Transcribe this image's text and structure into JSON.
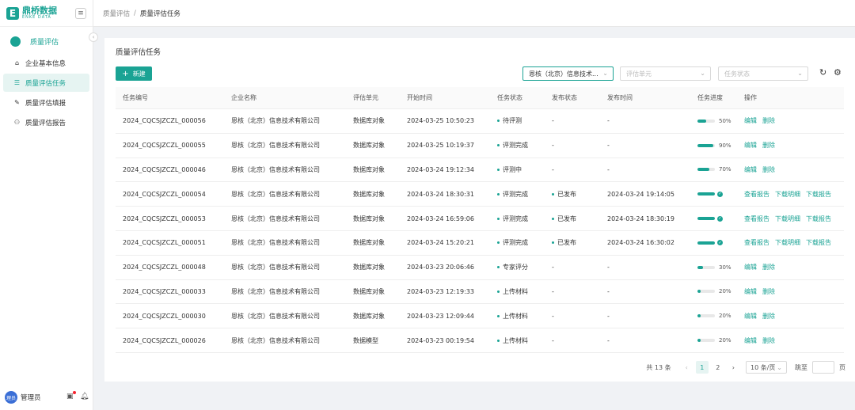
{
  "brand": {
    "logo_letter": "E",
    "name_cn": "鼎桥数据",
    "name_en": "ENKE DATA"
  },
  "sidebar": {
    "section_label": "质量评估",
    "items": [
      {
        "label": "企业基本信息",
        "icon": "building-icon",
        "glyph": "⌂",
        "active": false
      },
      {
        "label": "质量评估任务",
        "icon": "task-icon",
        "glyph": "☰",
        "active": true
      },
      {
        "label": "质量评估填报",
        "icon": "form-icon",
        "glyph": "✎",
        "active": false
      },
      {
        "label": "质量评估报告",
        "icon": "user-report-icon",
        "glyph": "⚇",
        "active": false
      }
    ]
  },
  "user": {
    "avatar_text": "理员",
    "name": "管理员"
  },
  "breadcrumb": {
    "parent": "质量评估",
    "separator": "/",
    "current": "质量评估任务"
  },
  "card": {
    "title": "质量评估任务",
    "new_button": "新建",
    "filters": {
      "company": "恩核（北京）信息技术...",
      "unit_placeholder": "评估单元",
      "status_placeholder": "任务状态"
    }
  },
  "colors": {
    "accent": "#1aa394"
  },
  "table": {
    "headers": [
      "任务编号",
      "企业名称",
      "评估单元",
      "开始时间",
      "任务状态",
      "发布状态",
      "发布时间",
      "任务进度",
      "操作"
    ],
    "rows": [
      {
        "code": "2024_CQCSJZCZL_000056",
        "company": "恩核（北京）信息技术有限公司",
        "unit": "数据库对象",
        "start": "2024-03-25 10:50:23",
        "status": "待评测",
        "pub_status": "-",
        "pub_time": "-",
        "progress": 50,
        "progress_label": "50%",
        "complete": false,
        "ops": [
          "编辑",
          "删除"
        ]
      },
      {
        "code": "2024_CQCSJZCZL_000055",
        "company": "恩核（北京）信息技术有限公司",
        "unit": "数据库对象",
        "start": "2024-03-25 10:19:37",
        "status": "评测完成",
        "pub_status": "-",
        "pub_time": "-",
        "progress": 90,
        "progress_label": "90%",
        "complete": false,
        "ops": [
          "编辑",
          "删除"
        ]
      },
      {
        "code": "2024_CQCSJZCZL_000046",
        "company": "恩核（北京）信息技术有限公司",
        "unit": "数据库对象",
        "start": "2024-03-24 19:12:34",
        "status": "评测中",
        "pub_status": "-",
        "pub_time": "-",
        "progress": 70,
        "progress_label": "70%",
        "complete": false,
        "ops": [
          "编辑",
          "删除"
        ]
      },
      {
        "code": "2024_CQCSJZCZL_000054",
        "company": "恩核（北京）信息技术有限公司",
        "unit": "数据库对象",
        "start": "2024-03-24 18:30:31",
        "status": "评测完成",
        "pub_status": "已发布",
        "pub_time": "2024-03-24 19:14:05",
        "progress": 100,
        "progress_label": "",
        "complete": true,
        "ops": [
          "查看报告",
          "下载明细",
          "下载报告"
        ]
      },
      {
        "code": "2024_CQCSJZCZL_000053",
        "company": "恩核（北京）信息技术有限公司",
        "unit": "数据库对象",
        "start": "2024-03-24 16:59:06",
        "status": "评测完成",
        "pub_status": "已发布",
        "pub_time": "2024-03-24 18:30:19",
        "progress": 100,
        "progress_label": "",
        "complete": true,
        "ops": [
          "查看报告",
          "下载明细",
          "下载报告"
        ]
      },
      {
        "code": "2024_CQCSJZCZL_000051",
        "company": "恩核（北京）信息技术有限公司",
        "unit": "数据库对象",
        "start": "2024-03-24 15:20:21",
        "status": "评测完成",
        "pub_status": "已发布",
        "pub_time": "2024-03-24 16:30:02",
        "progress": 100,
        "progress_label": "",
        "complete": true,
        "ops": [
          "查看报告",
          "下载明细",
          "下载报告"
        ]
      },
      {
        "code": "2024_CQCSJZCZL_000048",
        "company": "恩核（北京）信息技术有限公司",
        "unit": "数据库对象",
        "start": "2024-03-23 20:06:46",
        "status": "专家评分",
        "pub_status": "-",
        "pub_time": "-",
        "progress": 30,
        "progress_label": "30%",
        "complete": false,
        "ops": [
          "编辑",
          "删除"
        ]
      },
      {
        "code": "2024_CQCSJZCZL_000033",
        "company": "恩核（北京）信息技术有限公司",
        "unit": "数据库对象",
        "start": "2024-03-23 12:19:33",
        "status": "上传材料",
        "pub_status": "-",
        "pub_time": "-",
        "progress": 20,
        "progress_label": "20%",
        "complete": false,
        "ops": [
          "编辑",
          "删除"
        ]
      },
      {
        "code": "2024_CQCSJZCZL_000030",
        "company": "恩核（北京）信息技术有限公司",
        "unit": "数据库对象",
        "start": "2024-03-23 12:09:44",
        "status": "上传材料",
        "pub_status": "-",
        "pub_time": "-",
        "progress": 20,
        "progress_label": "20%",
        "complete": false,
        "ops": [
          "编辑",
          "删除"
        ]
      },
      {
        "code": "2024_CQCSJZCZL_000026",
        "company": "恩核（北京）信息技术有限公司",
        "unit": "数据模型",
        "start": "2024-03-23 00:19:54",
        "status": "上传材料",
        "pub_status": "-",
        "pub_time": "-",
        "progress": 20,
        "progress_label": "20%",
        "complete": false,
        "ops": [
          "编辑",
          "删除"
        ]
      }
    ]
  },
  "pagination": {
    "total": "共 13 条",
    "pages": [
      "1",
      "2"
    ],
    "current": "1",
    "page_size": "10 条/页",
    "goto_label": "跳至",
    "goto_unit": "页"
  }
}
